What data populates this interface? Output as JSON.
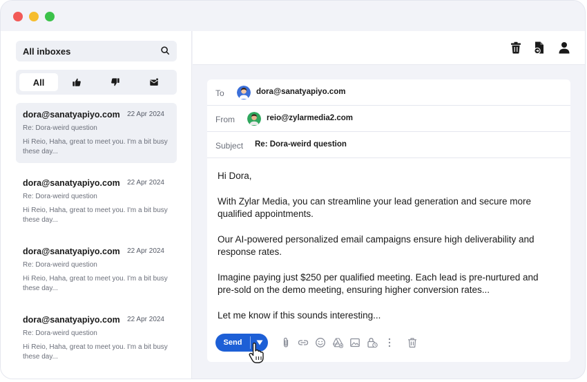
{
  "sidebar": {
    "search_label": "All inboxes",
    "filters": [
      "All"
    ],
    "mails": [
      {
        "sender": "dora@sanatyapiyo.com",
        "date": "22 Apr 2024",
        "subject": "Re: Dora-weird question",
        "preview": "Hi Reio, Haha, great to meet you. I'm a bit busy these day..."
      },
      {
        "sender": "dora@sanatyapiyo.com",
        "date": "22 Apr 2024",
        "subject": "Re: Dora-weird question",
        "preview": "Hi Reio, Haha, great to meet you. I'm a bit busy these day..."
      },
      {
        "sender": "dora@sanatyapiyo.com",
        "date": "22 Apr 2024",
        "subject": "Re: Dora-weird question",
        "preview": "Hi Reio, Haha, great to meet you. I'm a bit busy these day..."
      },
      {
        "sender": "dora@sanatyapiyo.com",
        "date": "22 Apr 2024",
        "subject": "Re: Dora-weird question",
        "preview": "Hi Reio, Haha, great to meet you. I'm a bit busy these day..."
      }
    ]
  },
  "compose": {
    "to_label": "To",
    "to_value": "dora@sanatyapiyo.com",
    "from_label": "From",
    "from_value": "reio@zylarmedia2.com",
    "subject_label": "Subject",
    "subject_value": "Re: Dora-weird question",
    "body": [
      "Hi Dora,",
      "With Zylar Media, you can streamline your lead generation and secure more qualified appointments.",
      "Our AI-powered personalized email campaigns ensure high deliverability and response rates.",
      "Imagine paying just $250 per qualified meeting. Each lead is pre-nurtured and pre-sold on the demo meeting, ensuring higher conversion rates...",
      "Let me know if this sounds interesting..."
    ],
    "send_label": "Send"
  },
  "colors": {
    "accent": "#1d5fd6",
    "window_bg": "#f2f3f8"
  },
  "icons": [
    "search-icon",
    "thumbs-up-icon",
    "thumbs-down-icon",
    "mail-icon",
    "trash-icon",
    "export-file-icon",
    "user-icon",
    "attach-icon",
    "link-icon",
    "emoji-icon",
    "drive-icon",
    "image-icon",
    "lock-clock-icon",
    "more-icon",
    "delete-icon"
  ]
}
